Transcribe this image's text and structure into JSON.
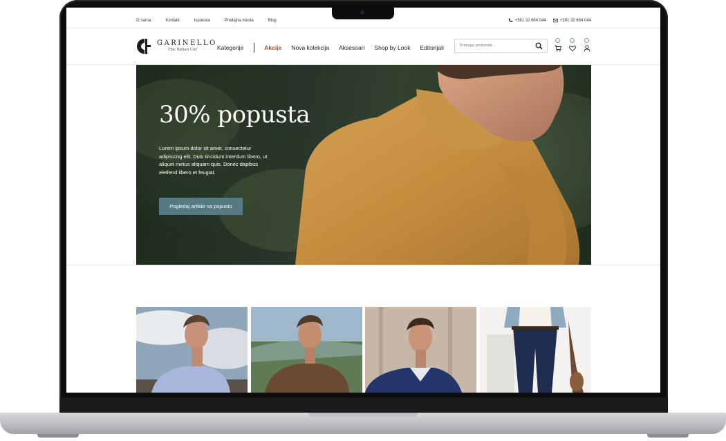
{
  "topbar": {
    "links": [
      "O nama",
      "Kontakt",
      "Isporuka",
      "Prodajna mesta",
      "Blog"
    ],
    "phone": "+381 32 664 044",
    "email_phone": "+381 32 664 044"
  },
  "brand": {
    "name": "GARINELLO",
    "tagline": "The Italian Cut"
  },
  "nav": {
    "categories": "Kategorije",
    "sale": "Akcije",
    "items": [
      "Nova kolekcija",
      "Aksesoari",
      "Shop by Look",
      "Editorijali"
    ],
    "sale_color": "#b5452a"
  },
  "search": {
    "placeholder": "Pretraga proizvoda..."
  },
  "header_icons": [
    "cart-icon",
    "heart-icon",
    "user-icon"
  ],
  "hero": {
    "title": "30% popusta",
    "text": "Lorem ipsum dolor sit amet, consectetur adipiscing elit. Duis tincidunt interdum libero, ut aliquet metus aliquam quis. Donec dapibus eleifend libero et feugiat.",
    "button": "Pogledaj artikle na popustu",
    "button_color": "#567a84"
  }
}
